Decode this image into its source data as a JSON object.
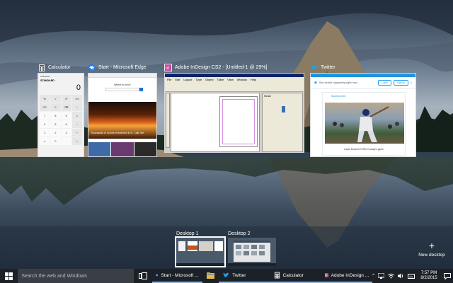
{
  "windows": {
    "calculator": {
      "title": "Calculator",
      "app_label": "Calculator",
      "mode": "STANDARD",
      "display": "0",
      "keys": [
        "%",
        "√",
        "x²",
        "1/x",
        "CE",
        "C",
        "⌫",
        "÷",
        "7",
        "8",
        "9",
        "×",
        "4",
        "5",
        "6",
        "−",
        "1",
        "2",
        "3",
        "+",
        "±",
        "0",
        ".",
        "="
      ]
    },
    "edge": {
      "title": "Start - Microsoft Edge",
      "prompt": "Where to next?",
      "headline": "Thousands of homes threatened in N. Calif. fire"
    },
    "indesign": {
      "title": "Adobe InDesign CS2 - [Untitled-1 @ 29%]",
      "menu": [
        "File",
        "Edit",
        "Layout",
        "Type",
        "Object",
        "Table",
        "View",
        "Window",
        "Help"
      ],
      "panel_label": "Stroke"
    },
    "twitter": {
      "title": "Twitter",
      "prompt": "See what's happening right now",
      "login": "Log in",
      "signup": "Sign up",
      "user": "SportsCenter",
      "caption": "Lucas Duda hit 3 HRs in today's game"
    }
  },
  "desktops": [
    {
      "label": "Desktop 1",
      "active": true
    },
    {
      "label": "Desktop 2",
      "active": false
    }
  ],
  "new_desktop": {
    "label": "New desktop",
    "icon": "+"
  },
  "taskbar": {
    "search_placeholder": "Search the web and Windows",
    "apps": [
      {
        "label": "Start - Microsoft ...",
        "icon": "edge-icon"
      },
      {
        "label": "",
        "icon": "file-explorer-icon"
      },
      {
        "label": "Twitter",
        "icon": "twitter-icon"
      },
      {
        "label": "Calculator",
        "icon": "calculator-icon"
      },
      {
        "label": "Adobe InDesign ...",
        "icon": "indesign-icon"
      }
    ],
    "tray": {
      "chevron": "^"
    },
    "clock": {
      "time": "7:57 PM",
      "date": "8/2/2015"
    }
  },
  "colors": {
    "taskbar_bg": "#1c2128",
    "accent": "#1b95e0",
    "edge_blue": "#1e6fd0",
    "twitter_blue": "#1da1f2"
  }
}
